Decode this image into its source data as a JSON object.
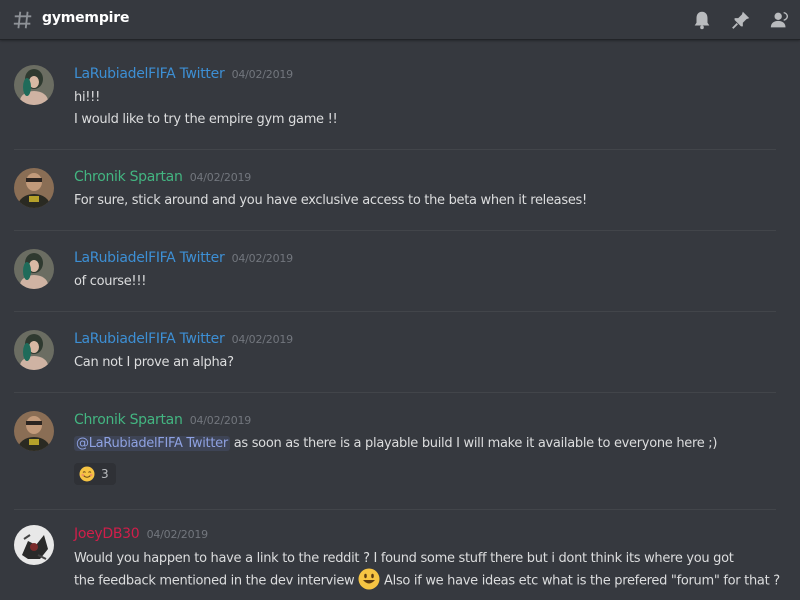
{
  "channel": {
    "name": "gymempire"
  },
  "colors": {
    "background": "#36393f",
    "username_blue": "#3d8fd4",
    "username_green": "#43b581",
    "username_red": "#d01e4a",
    "timestamp": "#72767d",
    "text": "#dcddde"
  },
  "header_icons": [
    "bell-icon",
    "pin-icon",
    "members-icon"
  ],
  "messages": [
    {
      "author": "LaRubiadelFIFA Twitter",
      "timestamp": "04/02/2019",
      "lines": [
        "hi!!!",
        "I would like to try the empire gym game !!"
      ]
    },
    {
      "author": "Chronik Spartan",
      "timestamp": "04/02/2019",
      "lines": [
        "For sure, stick around and you have exclusive access to the beta when it releases!"
      ]
    },
    {
      "author": "LaRubiadelFIFA Twitter",
      "timestamp": "04/02/2019",
      "lines": [
        "of course!!!"
      ]
    },
    {
      "author": "LaRubiadelFIFA Twitter",
      "timestamp": "04/02/2019",
      "lines": [
        "Can not I prove an alpha?"
      ]
    },
    {
      "author": "Chronik Spartan",
      "timestamp": "04/02/2019",
      "mention": "@LaRubiadelFIFA Twitter",
      "lines": [
        " as soon as there is a playable build I will make it available to everyone here ;)"
      ],
      "reaction": {
        "emoji": "smiling-blush-emoji",
        "count": "3"
      }
    },
    {
      "author": "JoeyDB30",
      "timestamp": "04/02/2019",
      "lines": [
        "Would you happen to have a link to the reddit ? I found some stuff there but i dont think its where you got",
        "the feedback mentioned in the dev interview",
        " Also if we have ideas etc what is the prefered \"forum\" for that ?"
      ]
    }
  ]
}
